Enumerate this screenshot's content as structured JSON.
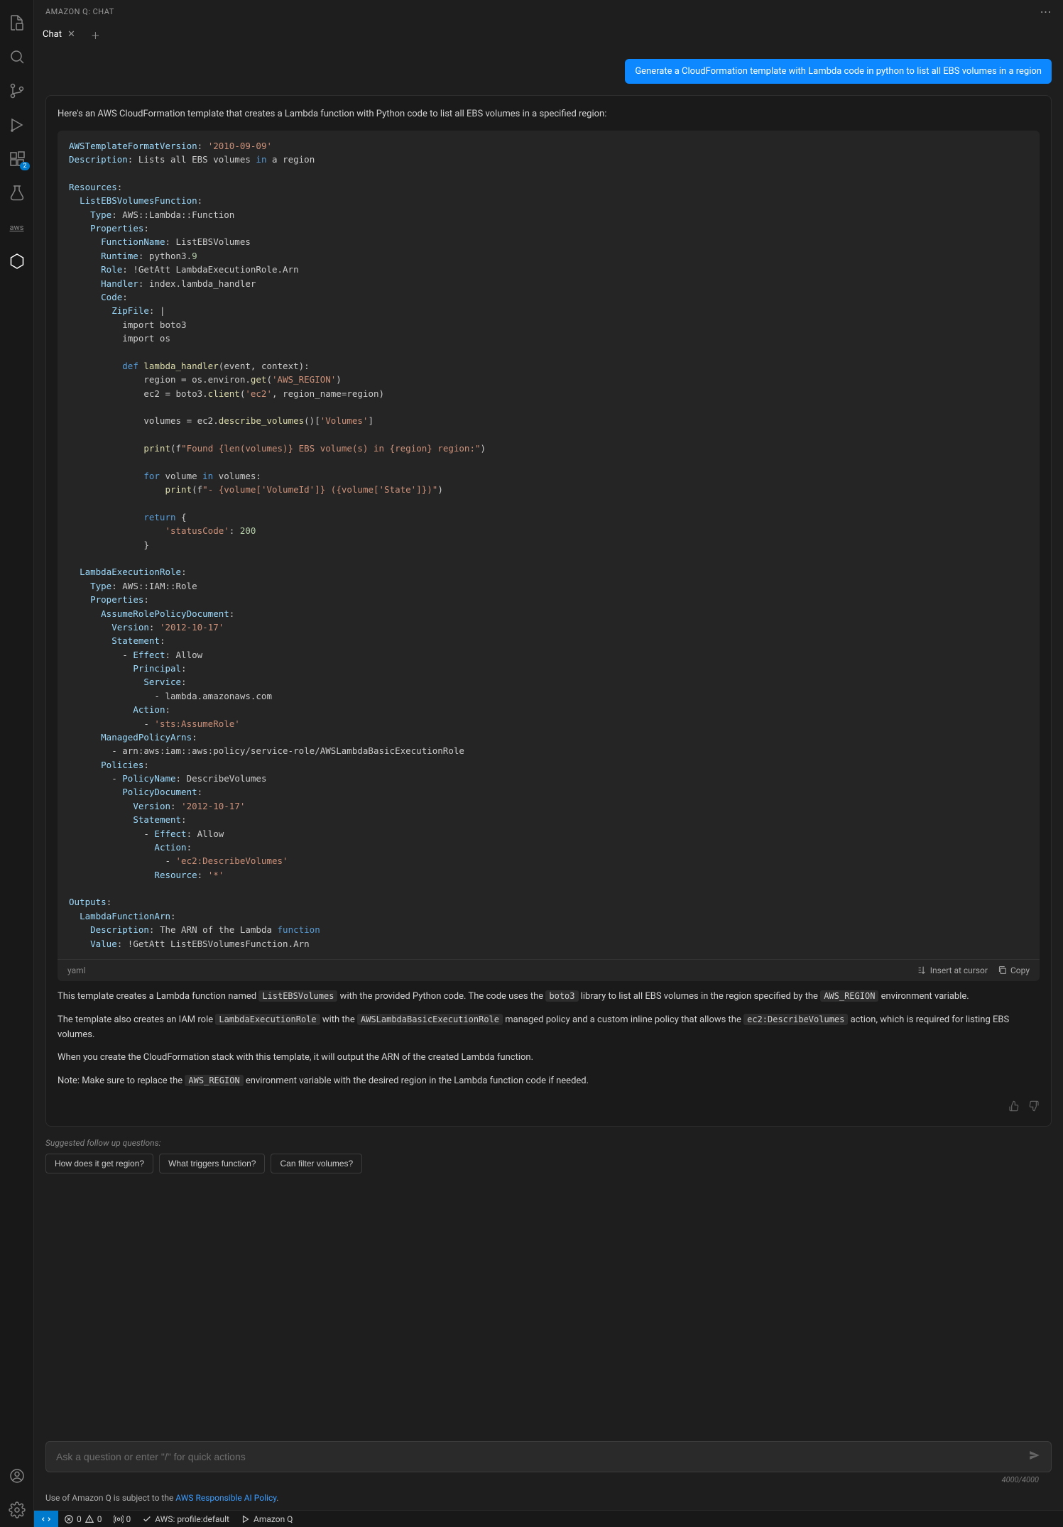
{
  "title": "AMAZON Q: CHAT",
  "tab": {
    "label": "Chat"
  },
  "activity": {
    "badge": "2"
  },
  "user_prompt": "Generate a CloudFormation template with Lambda code in python to list all EBS volumes in a region",
  "assistant": {
    "intro": "Here's an AWS CloudFormation template that creates a Lambda function with Python code to list all EBS volumes in a specified region:",
    "code_lang": "yaml",
    "insert_label": "Insert at cursor",
    "copy_label": "Copy",
    "p1_a": "This template creates a Lambda function named ",
    "p1_code1": "ListEBSVolumes",
    "p1_b": " with the provided Python code. The code uses the ",
    "p1_code2": "boto3",
    "p1_c": " library to list all EBS volumes in the region specified by the ",
    "p1_code3": "AWS_REGION",
    "p1_d": " environment variable.",
    "p2_a": "The template also creates an IAM role ",
    "p2_code1": "LambdaExecutionRole",
    "p2_b": " with the ",
    "p2_code2": "AWSLambdaBasicExecutionRole",
    "p2_c": " managed policy and a custom inline policy that allows the ",
    "p2_code3": "ec2:DescribeVolumes",
    "p2_d": " action, which is required for listing EBS volumes.",
    "p3": "When you create the CloudFormation stack with this template, it will output the ARN of the created Lambda function.",
    "p4_a": "Note: Make sure to replace the ",
    "p4_code1": "AWS_REGION",
    "p4_b": " environment variable with the desired region in the Lambda function code if needed."
  },
  "followups": {
    "label": "Suggested follow up questions:",
    "items": [
      "How does it get region?",
      "What triggers function?",
      "Can filter volumes?"
    ]
  },
  "input": {
    "placeholder": "Ask a question or enter \"/\" for quick actions",
    "counter": "4000/4000"
  },
  "policy": {
    "prefix": "Use of Amazon Q is subject to the ",
    "link": "AWS Responsible AI Policy",
    "suffix": "."
  },
  "status": {
    "errors": "0",
    "warnings": "0",
    "ports": "0",
    "profile": "AWS: profile:default",
    "q": "Amazon Q"
  }
}
